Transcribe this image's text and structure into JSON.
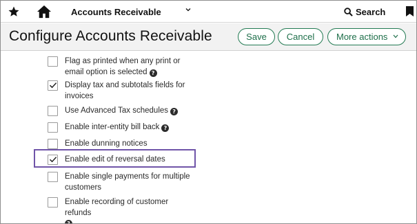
{
  "topbar": {
    "module": "Accounts Receivable",
    "search_label": "Search",
    "icons": [
      "star-icon",
      "home-icon",
      "chevron-down-icon",
      "search-icon",
      "bookmark-icon"
    ]
  },
  "header": {
    "title": "Configure Accounts Receivable",
    "save_label": "Save",
    "cancel_label": "Cancel",
    "more_actions_label": "More actions"
  },
  "options": [
    {
      "line1": "Flag as printed when any print or",
      "line2": "email option is selected",
      "checked": false,
      "help": true
    },
    {
      "line1": "Display tax and subtotals fields for",
      "line2": "invoices",
      "checked": true,
      "help": false
    },
    {
      "line1": "Use Advanced Tax schedules",
      "checked": false,
      "help": true
    },
    {
      "line1": "Enable inter-entity bill back",
      "checked": false,
      "help": true
    },
    {
      "line1": "Enable dunning notices",
      "checked": false,
      "help": false
    },
    {
      "line1": "Enable edit of reversal dates",
      "checked": true,
      "help": false,
      "highlighted": true
    },
    {
      "line1": "Enable single payments for multiple",
      "line2": "customers",
      "checked": false,
      "help": false
    },
    {
      "line1": "Enable recording of customer refunds",
      "checked": false,
      "help": true
    }
  ],
  "colors": {
    "accent_green": "#227a52",
    "highlight_purple": "#6f54a8",
    "header_bg": "#f2f2f2"
  }
}
